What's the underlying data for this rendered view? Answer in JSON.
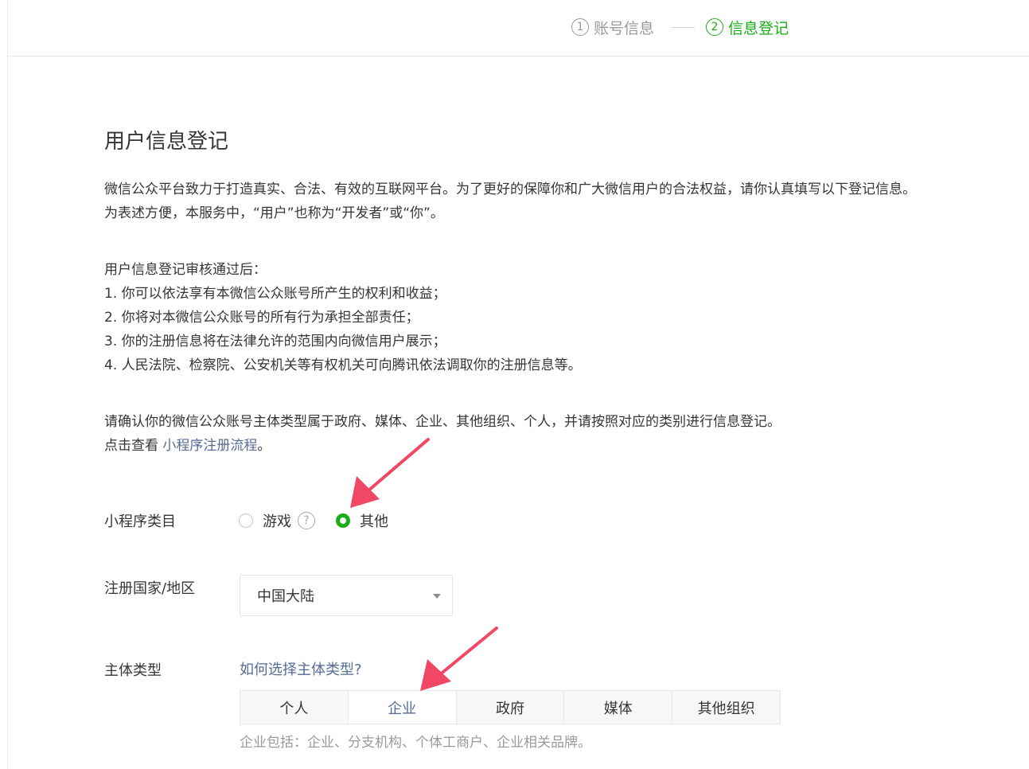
{
  "steps": [
    {
      "num": "1",
      "label": "账号信息"
    },
    {
      "num": "2",
      "label": "信息登记"
    }
  ],
  "page_title": "用户信息登记",
  "intro": [
    "微信公众平台致力于打造真实、合法、有效的互联网平台。为了更好的保障你和广大微信用户的合法权益，请你认真填写以下登记信息。",
    "为表述方便，本服务中，“用户”也称为“开发者”或“你”。"
  ],
  "after_review": {
    "heading": "用户信息登记审核通过后：",
    "items": [
      "1. 你可以依法享有本微信公众账号所产生的权利和收益；",
      "2. 你将对本微信公众账号的所有行为承担全部责任；",
      "3. 你的注册信息将在法律允许的范围内向微信用户展示；",
      "4. 人民法院、检察院、公安机关等有权机关可向腾讯依法调取你的注册信息等。"
    ]
  },
  "confirm": {
    "line1": "请确认你的微信公众账号主体类型属于政府、媒体、企业、其他组织、个人，并请按照对应的类别进行信息登记。",
    "line2_prefix": "点击查看 ",
    "line2_link": "小程序注册流程",
    "line2_suffix": "。"
  },
  "category": {
    "label": "小程序类目",
    "options": [
      "游戏",
      "其他"
    ],
    "help_icon": "?",
    "selected": "其他"
  },
  "region": {
    "label": "注册国家/地区",
    "value": "中国大陆"
  },
  "entity_type": {
    "label": "主体类型",
    "help_link": "如何选择主体类型?",
    "options": [
      "个人",
      "企业",
      "政府",
      "媒体",
      "其他组织"
    ],
    "selected": "企业",
    "hint": "企业包括：企业、分支机构、个体工商户、企业相关品牌。"
  },
  "colors": {
    "accent_green": "#1aad19",
    "link_blue": "#576b95",
    "annotation_arrow": "#f04864"
  }
}
